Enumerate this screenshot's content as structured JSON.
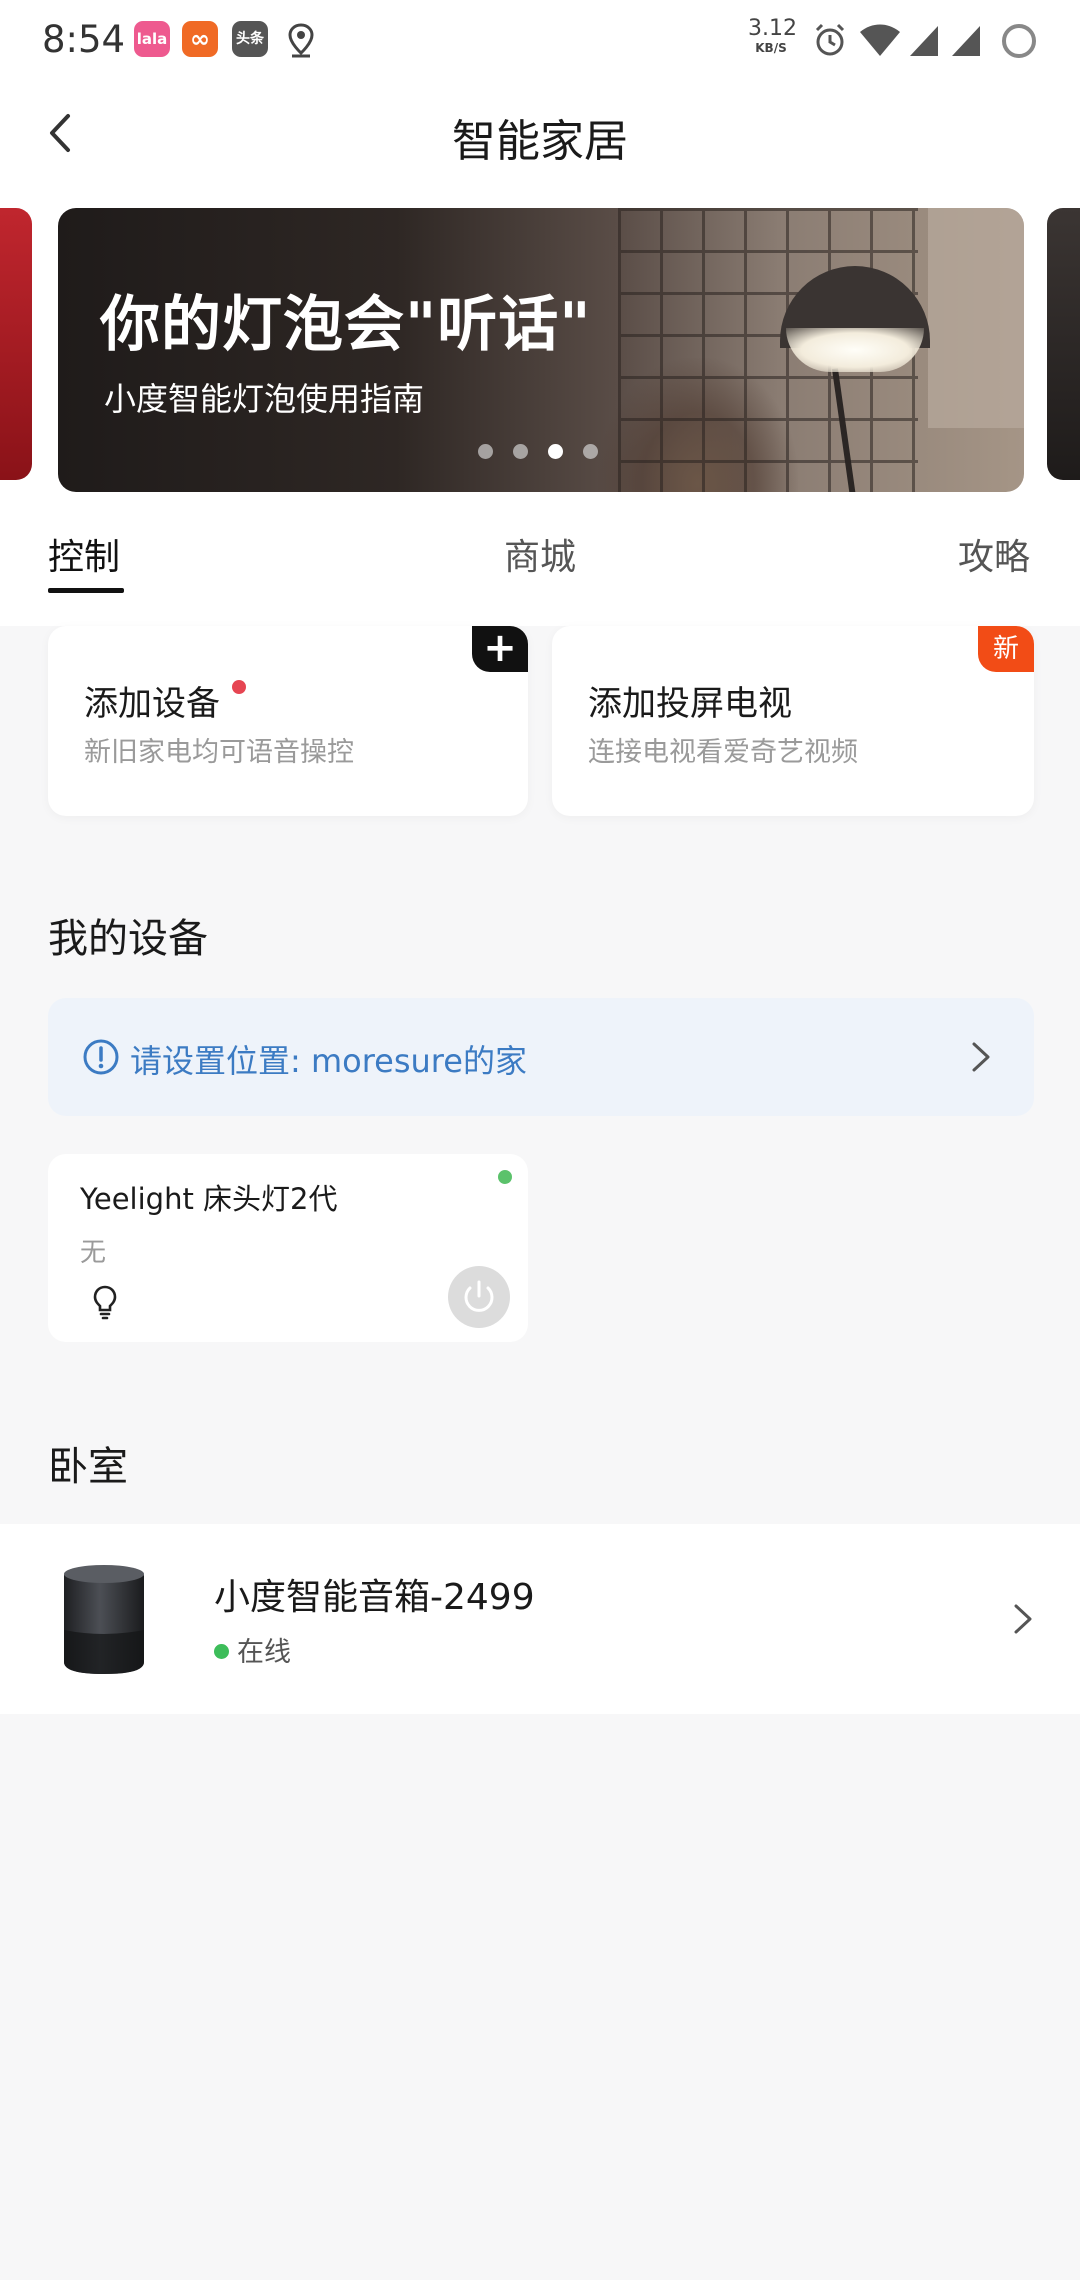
{
  "status_bar": {
    "time": "8:54",
    "app_icons": [
      {
        "name": "lala-app-icon",
        "text": "lala",
        "color": "#ee5a8f"
      },
      {
        "name": "infinity-app-icon",
        "text": "∞",
        "color": "#f06a25"
      },
      {
        "name": "toutiao-app-icon",
        "text": "头条",
        "color": "#555555"
      }
    ],
    "net_speed_value": "3.12",
    "net_speed_unit": "KB/S"
  },
  "header": {
    "title": "智能家居"
  },
  "banner": {
    "title": "你的灯泡会\"听话\"",
    "subtitle": "小度智能灯泡使用指南",
    "page_count": 4,
    "active_index": 2
  },
  "tabs": [
    {
      "label": "控制",
      "active": true
    },
    {
      "label": "商城",
      "active": false
    },
    {
      "label": "攻略",
      "active": false
    }
  ],
  "action_cards": {
    "add_device": {
      "title": "添加设备",
      "subtitle": "新旧家电均可语音操控",
      "corner": "+"
    },
    "add_tv": {
      "title": "添加投屏电视",
      "subtitle": "连接电视看爱奇艺视频",
      "badge": "新"
    }
  },
  "my_devices": {
    "section_title": "我的设备",
    "notice_text": "请设置位置: moresure的家",
    "device": {
      "name": "Yeelight 床头灯2代",
      "room": "无",
      "online": true
    }
  },
  "bedroom": {
    "section_title": "卧室",
    "device": {
      "name": "小度智能音箱-2499",
      "status": "在线"
    }
  },
  "colors": {
    "accent_blue": "#3c7bc3",
    "badge_orange": "#f24c16",
    "online_green": "#3dbd5a",
    "red_dot": "#e64552"
  }
}
